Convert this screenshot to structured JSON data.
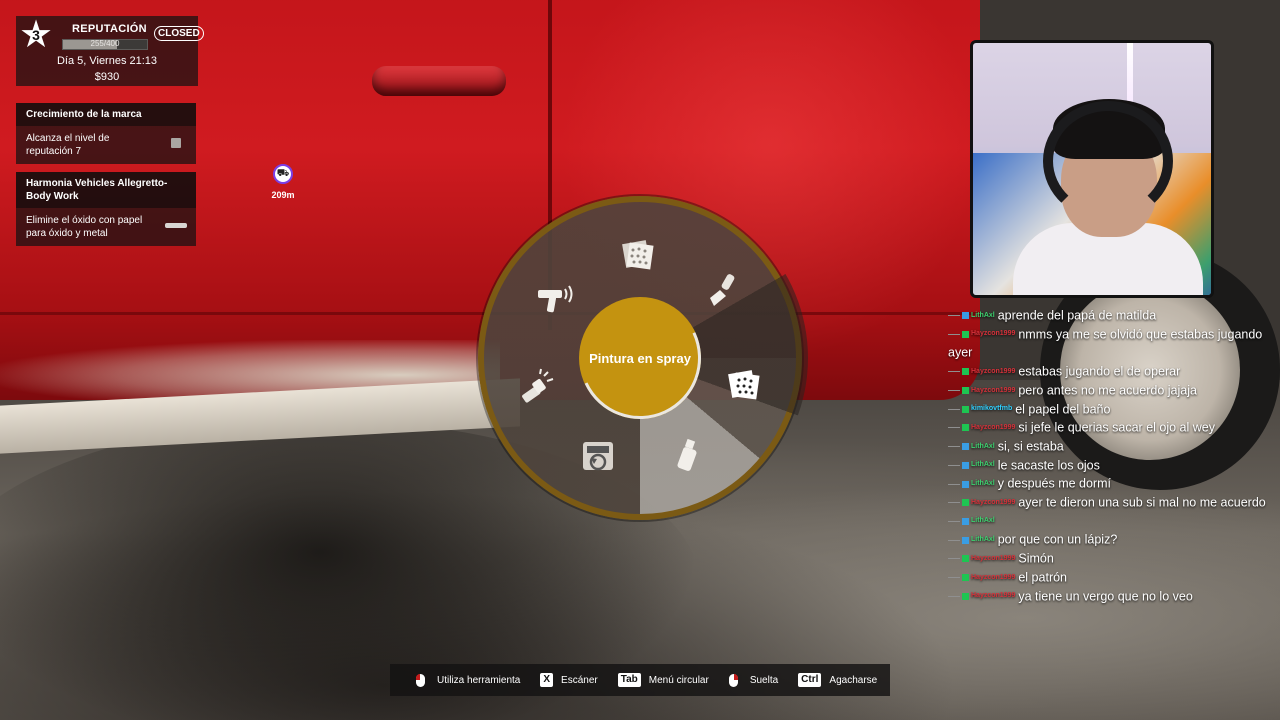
{
  "hud": {
    "reputation": {
      "level": "3",
      "title": "REPUTACIÓN",
      "progress_text": "255/400",
      "progress_fraction": 0.6375,
      "status_badge": "CLOSED",
      "date": "Día 5, Viernes 21:13",
      "money": "$930"
    },
    "objectives": [
      {
        "title": "Crecimiento de la marca",
        "task": "Alcanza el nivel de reputación 7",
        "indicator": "checkbox"
      },
      {
        "title": "Harmonia Vehicles Allegretto- Body Work",
        "task": "Elimine el óxido con papel para óxido y metal",
        "indicator": "progress"
      }
    ],
    "marker": {
      "icon": "car-icon",
      "distance": "209m"
    }
  },
  "radial_menu": {
    "center_label": "Pintura en spray",
    "tools": [
      {
        "name": "sandpaper",
        "icon": "sandpaper-icon"
      },
      {
        "name": "scraper",
        "icon": "scraper-icon"
      },
      {
        "name": "rust-paper",
        "icon": "sandpaper-icon"
      },
      {
        "name": "spray-can",
        "icon": "spray-can-icon"
      },
      {
        "name": "scanner-reset",
        "icon": "scanner-icon"
      },
      {
        "name": "flashlight",
        "icon": "flashlight-icon"
      },
      {
        "name": "spray-gun",
        "icon": "spray-gun-icon"
      }
    ],
    "colors": {
      "center": "#c49310",
      "rim": "#7b5a14"
    }
  },
  "chat": [
    {
      "user": "LithAxl",
      "msg": "aprende del papá de matilda",
      "color": "#3ccf6e",
      "badge": "sub"
    },
    {
      "user": "Hayzcon1999",
      "msg": "nmms ya me se olvidó que estabas jugando ayer",
      "color": "#d6313a",
      "badge": "mod"
    },
    {
      "user": "Hayzcon1999",
      "msg": "estabas jugando el de operar",
      "color": "#d6313a",
      "badge": "mod"
    },
    {
      "user": "Hayzcon1999",
      "msg": "pero antes no me acuerdo jajaja",
      "color": "#d6313a",
      "badge": "mod"
    },
    {
      "user": "kimikovtfmb",
      "msg": "el papel del baño",
      "color": "#2fd0ff",
      "badge": "mod"
    },
    {
      "user": "Hayzcon1999",
      "msg": "si jefe le querias sacar el ojo al wey",
      "color": "#d6313a",
      "badge": "mod"
    },
    {
      "user": "LithAxl",
      "msg": "si, si estaba",
      "color": "#3ccf6e",
      "badge": "sub"
    },
    {
      "user": "LithAxl",
      "msg": "le sacaste los ojos",
      "color": "#3ccf6e",
      "badge": "sub"
    },
    {
      "user": "LithAxl",
      "msg": "y después me dormí",
      "color": "#3ccf6e",
      "badge": "sub"
    },
    {
      "user": "Hayzcon1999",
      "msg": "ayer te dieron una sub si mal no me acuerdo",
      "color": "#d6313a",
      "badge": "mod"
    },
    {
      "user": "LithAxl",
      "msg": "",
      "color": "#3ccf6e",
      "badge": "sub"
    },
    {
      "user": "LithAxl",
      "msg": "por que con un lápiz?",
      "color": "#3ccf6e",
      "badge": "sub"
    },
    {
      "user": "Hayzcon1999",
      "msg": "Simón",
      "color": "#d6313a",
      "badge": "mod"
    },
    {
      "user": "Hayzcon1999",
      "msg": "el patrón",
      "color": "#d6313a",
      "badge": "mod"
    },
    {
      "user": "Hayzcon1999",
      "msg": "ya tiene un vergo que no lo veo",
      "color": "#d6313a",
      "badge": "mod"
    }
  ],
  "hints": [
    {
      "input": "mouse-left",
      "key": "",
      "label": "Utiliza herramienta"
    },
    {
      "input": "key",
      "key": "X",
      "label": "Escáner"
    },
    {
      "input": "key",
      "key": "Tab",
      "label": "Menú circular"
    },
    {
      "input": "mouse-right",
      "key": "",
      "label": "Suelta"
    },
    {
      "input": "key",
      "key": "Ctrl",
      "label": "Agacharse"
    }
  ]
}
